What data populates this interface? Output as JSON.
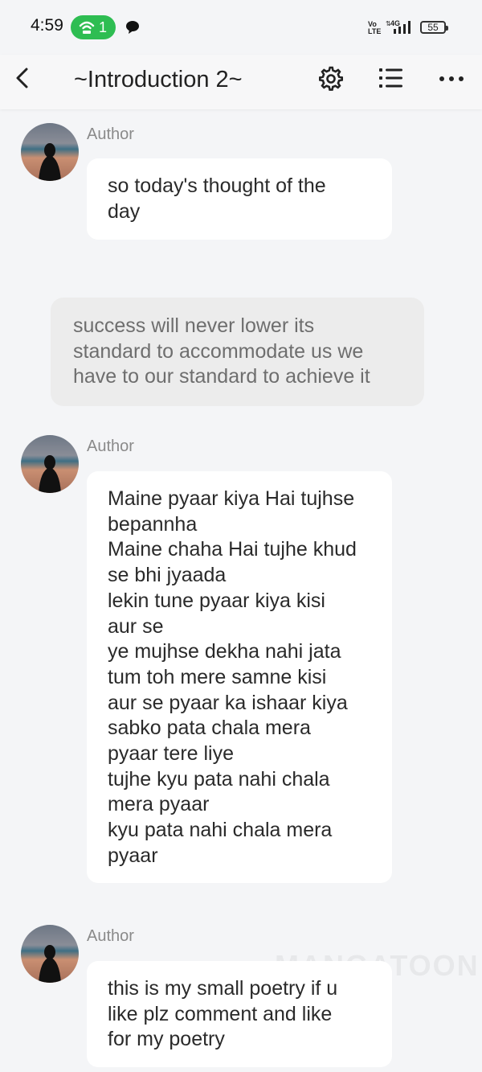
{
  "status_bar": {
    "time": "4:59",
    "hotspot_count": "1",
    "volte_label": "Vo\nLTE",
    "network_label": "4G",
    "battery": "55",
    "accent": "#2ebd52"
  },
  "header": {
    "title": "~Introduction 2~",
    "icons": [
      "back-arrow-icon",
      "gear-icon",
      "list-icon",
      "more-icon"
    ]
  },
  "messages": [
    {
      "author": "Author",
      "lines": [
        "so today's thought of the",
        "day"
      ]
    },
    {
      "narration": true,
      "lines": [
        "success will never lower its",
        "standard to accommodate us we",
        "have to our standard to achieve it"
      ]
    },
    {
      "author": "Author",
      "lines": [
        "Maine pyaar kiya Hai tujhse",
        "bepannha",
        "Maine chaha Hai tujhe khud",
        "se bhi jyaada",
        "lekin tune pyaar kiya kisi",
        "aur se",
        "ye mujhse dekha nahi jata",
        "tum toh mere samne kisi",
        "aur se pyaar ka ishaar kiya",
        "sabko pata chala mera",
        "pyaar tere liye",
        "tujhe kyu pata nahi chala",
        "mera pyaar",
        "kyu pata nahi chala mera",
        "pyaar"
      ]
    },
    {
      "author": "Author",
      "lines": [
        "this is my small poetry if u",
        "like plz comment and like",
        "for my poetry"
      ]
    }
  ],
  "watermark": "MANGATOON"
}
